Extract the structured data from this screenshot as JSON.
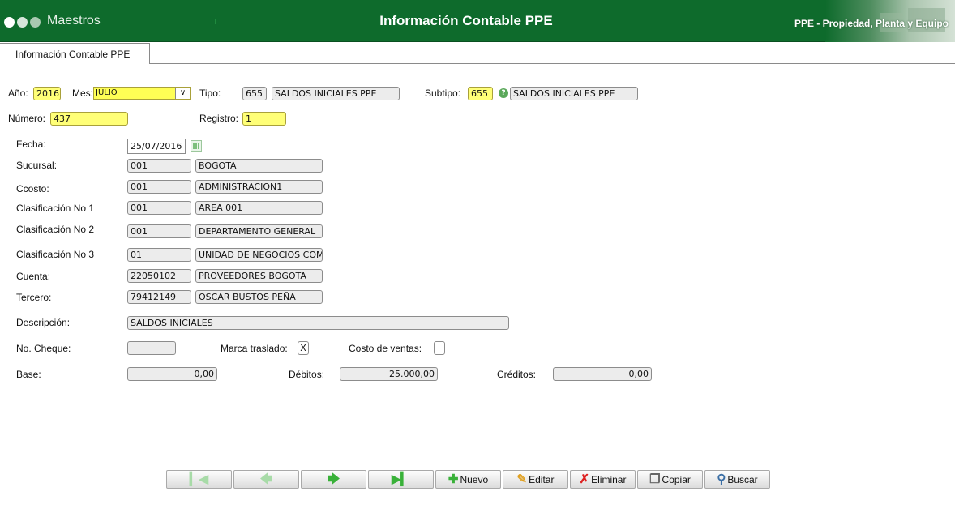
{
  "header": {
    "app_name": "Maestros",
    "title": "Información Contable PPE",
    "module": "PPE - Propiedad, Planta y Equipo"
  },
  "tabs": [
    {
      "label": "Información Contable PPE"
    }
  ],
  "form": {
    "anio": {
      "label": "Año:",
      "value": "2016"
    },
    "mes": {
      "label": "Mes:",
      "value": "JULIO"
    },
    "tipo": {
      "label": "Tipo:",
      "code": "655",
      "name": "SALDOS INICIALES PPE"
    },
    "subtipo": {
      "label": "Subtipo:",
      "code": "655",
      "name": "SALDOS INICIALES PPE"
    },
    "numero": {
      "label": "Número:",
      "value": "437"
    },
    "registro": {
      "label": "Registro:",
      "value": "1"
    },
    "fecha": {
      "label": "Fecha:",
      "value": "25/07/2016"
    },
    "sucursal": {
      "label": "Sucursal:",
      "code": "001",
      "name": "BOGOTA"
    },
    "ccosto": {
      "label": "Ccosto:",
      "code": "001",
      "name": "ADMINISTRACION1"
    },
    "clasif1": {
      "label": "Clasificación No 1",
      "code": "001",
      "name": "AREA 001"
    },
    "clasif2": {
      "label": "Clasificación No 2",
      "code": "001",
      "name": "DEPARTAMENTO GENERAL"
    },
    "clasif3": {
      "label": "Clasificación No 3",
      "code": "01",
      "name": "UNIDAD DE NEGOCIOS COM"
    },
    "cuenta": {
      "label": "Cuenta:",
      "code": "22050102",
      "name": "PROVEEDORES BOGOTA"
    },
    "tercero": {
      "label": "Tercero:",
      "code": "79412149",
      "name": "OSCAR BUSTOS PEÑA"
    },
    "descripcion": {
      "label": "Descripción:",
      "value": "SALDOS INICIALES"
    },
    "cheque": {
      "label": "No. Cheque:",
      "value": ""
    },
    "marca": {
      "label": "Marca traslado:",
      "value": "X"
    },
    "costo": {
      "label": "Costo de ventas:",
      "value": ""
    },
    "base": {
      "label": "Base:",
      "value": "0,00"
    },
    "debitos": {
      "label": "Débitos:",
      "value": "25.000,00"
    },
    "creditos": {
      "label": "Créditos:",
      "value": "0,00"
    }
  },
  "toolbar": {
    "nuevo": "Nuevo",
    "editar": "Editar",
    "eliminar": "Eliminar",
    "copiar": "Copiar",
    "buscar": "Buscar"
  },
  "colors": {
    "header_green": "#0e6b2c",
    "required_yellow": "#ffff77"
  }
}
